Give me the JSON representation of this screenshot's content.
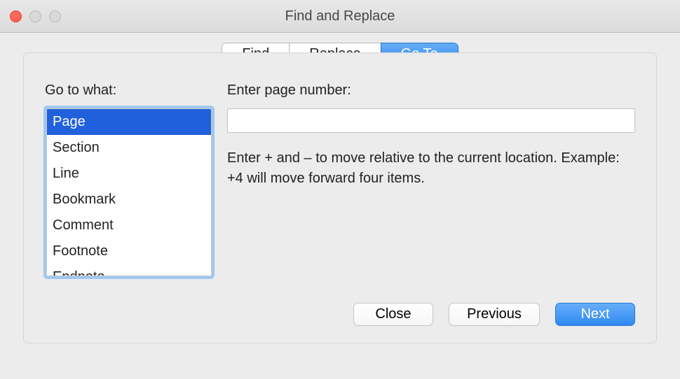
{
  "window": {
    "title": "Find and Replace"
  },
  "tabs": {
    "find": "Find",
    "replace": "Replace",
    "goto": "Go To",
    "active": "goto"
  },
  "left": {
    "label": "Go to what:",
    "items": [
      "Page",
      "Section",
      "Line",
      "Bookmark",
      "Comment",
      "Footnote",
      "Endnote"
    ],
    "selected": 0
  },
  "right": {
    "label": "Enter page number:",
    "value": "",
    "hint": "Enter + and – to move relative to the current location. Example: +4 will move forward four items."
  },
  "buttons": {
    "close": "Close",
    "previous": "Previous",
    "next": "Next"
  }
}
